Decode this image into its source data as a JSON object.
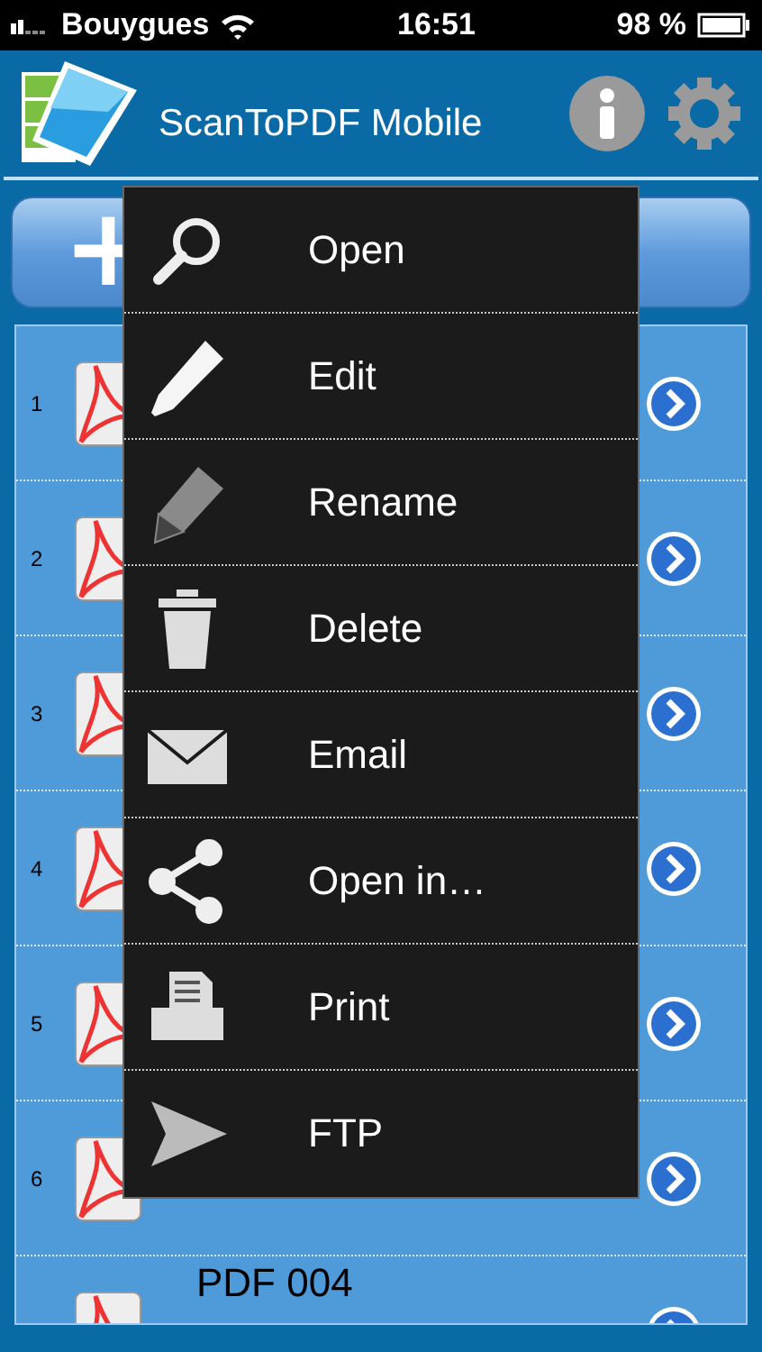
{
  "status_bar": {
    "carrier": "Bouygues",
    "time": "16:51",
    "battery": "98 %"
  },
  "header": {
    "title": "ScanToPDF Mobile"
  },
  "add_button": {
    "label": "+"
  },
  "documents": [
    {
      "number": "1"
    },
    {
      "number": "2"
    },
    {
      "number": "3"
    },
    {
      "number": "4"
    },
    {
      "number": "5"
    },
    {
      "number": "6"
    },
    {
      "title": "PDF 004"
    }
  ],
  "menu": [
    {
      "kind": "search",
      "label": "Open"
    },
    {
      "kind": "pencil",
      "label": "Edit"
    },
    {
      "kind": "eraser",
      "label": "Rename"
    },
    {
      "kind": "trash",
      "label": "Delete"
    },
    {
      "kind": "mail",
      "label": "Email"
    },
    {
      "kind": "share",
      "label": "Open in…"
    },
    {
      "kind": "printer",
      "label": "Print"
    },
    {
      "kind": "send",
      "label": "FTP"
    }
  ]
}
